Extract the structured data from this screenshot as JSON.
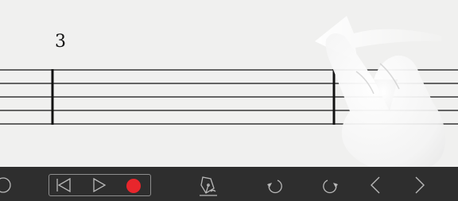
{
  "score": {
    "measure_number": "3"
  },
  "gesture": {
    "icon": "swipe-left-hand-icon"
  },
  "toolbar": {
    "items": [
      {
        "name": "partial-circle-button",
        "icon": "circle-icon"
      },
      {
        "name": "skip-to-start-button",
        "icon": "skip-back-icon"
      },
      {
        "name": "play-button",
        "icon": "play-icon"
      },
      {
        "name": "record-button",
        "icon": "record-dot-icon"
      },
      {
        "name": "pen-edit-button",
        "icon": "pen-icon"
      },
      {
        "name": "undo-button",
        "icon": "undo-icon"
      },
      {
        "name": "redo-button",
        "icon": "redo-icon"
      },
      {
        "name": "previous-button",
        "icon": "chevron-left-icon"
      },
      {
        "name": "next-button",
        "icon": "chevron-right-icon"
      }
    ],
    "record_color": "#e8262c",
    "icon_color": "#b8b8b8"
  }
}
